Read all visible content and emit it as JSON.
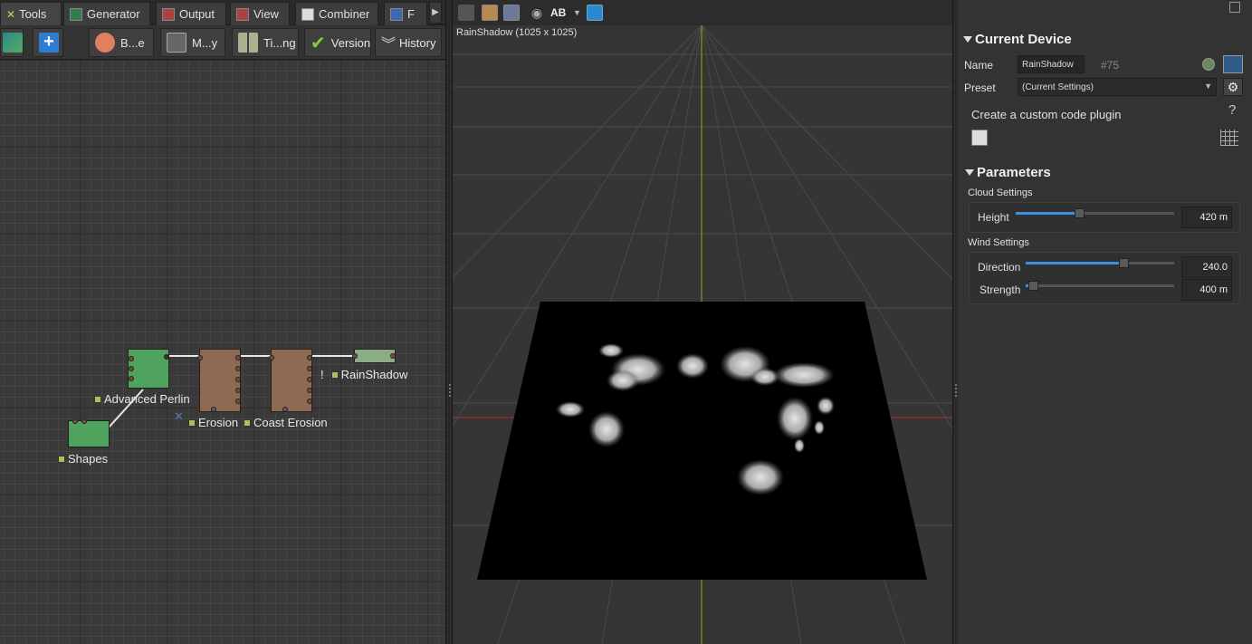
{
  "tabs": [
    {
      "label": "Tools",
      "icon": "tools-icon"
    },
    {
      "label": "Generator",
      "icon": "generator-icon"
    },
    {
      "label": "Output",
      "icon": "output-icon"
    },
    {
      "label": "View",
      "icon": "view-icon"
    },
    {
      "label": "Combiner",
      "icon": "combiner-icon"
    },
    {
      "label": "F",
      "icon": "filter-icon"
    }
  ],
  "toolbar": {
    "b1_label": "B...e",
    "b2_label": "M...y",
    "b3_label": "Ti...ng",
    "version_label": "Version",
    "history_label": "History"
  },
  "graph": {
    "nodes": {
      "advanced_perlin": "Advanced Perlin",
      "shapes": "Shapes",
      "erosion": "Erosion",
      "coast_erosion": "Coast Erosion",
      "rainshadow": "RainShadow",
      "warning_mark": "!"
    }
  },
  "viewport": {
    "title": "RainShadow (1025 x 1025)",
    "ab_label": "AB"
  },
  "device": {
    "section_title": "Current Device",
    "name_label": "Name",
    "name_value": "RainShadow",
    "id": "#75",
    "preset_label": "Preset",
    "preset_value": "(Current Settings)",
    "plugin_text": "Create a custom code plugin",
    "help": "?"
  },
  "params": {
    "section_title": "Parameters",
    "cloud_group": "Cloud Settings",
    "height_label": "Height",
    "height_value": "420 m",
    "height_fraction": 0.4,
    "wind_group": "Wind Settings",
    "direction_label": "Direction",
    "direction_value": "240.0",
    "direction_fraction": 0.66,
    "strength_label": "Strength",
    "strength_value": "400 m",
    "strength_fraction": 0.05
  },
  "colors": {
    "accent": "#3e8fe0",
    "node_green": "#4fa35e",
    "node_brown": "#8e6a52"
  }
}
